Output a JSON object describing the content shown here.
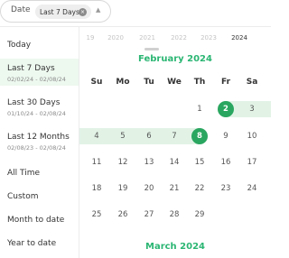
{
  "filter": {
    "label": "Date",
    "chip_text": "Last 7 Days",
    "chip_close_icon": "×",
    "chevron_icon": "▲"
  },
  "presets": [
    {
      "label": "Today",
      "range": ""
    },
    {
      "label": "Last 7 Days",
      "range": "02/02/24 - 02/08/24",
      "selected": true
    },
    {
      "label": "Last 30 Days",
      "range": "01/10/24 - 02/08/24"
    },
    {
      "label": "Last 12 Months",
      "range": "02/08/23 - 02/08/24"
    },
    {
      "label": "All Time",
      "range": ""
    },
    {
      "label": "Custom",
      "range": ""
    },
    {
      "label": "Month to date",
      "range": ""
    },
    {
      "label": "Year to date",
      "range": ""
    }
  ],
  "calendar": {
    "years": [
      "19",
      "2020",
      "2021",
      "2022",
      "2023",
      "2024"
    ],
    "active_year": "2024",
    "month_title": "February 2024",
    "next_month_title": "March 2024",
    "weekdays": [
      "Su",
      "Mo",
      "Tu",
      "We",
      "Th",
      "Fr",
      "Sa"
    ],
    "first_weekday_index": 4,
    "days_in_month": 29,
    "range_start": 2,
    "range_end": 8,
    "accent_color": "#2bb673",
    "range_color": "#e2f3e6"
  }
}
